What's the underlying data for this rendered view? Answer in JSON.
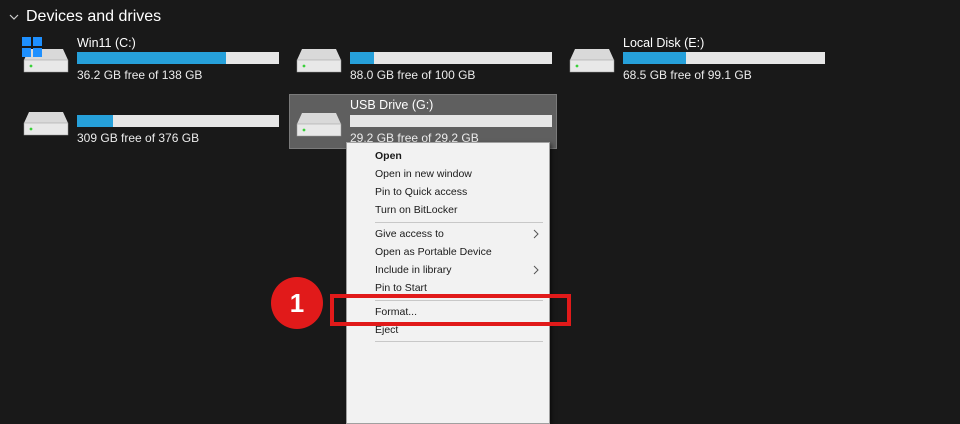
{
  "section": {
    "title": "Devices and drives"
  },
  "drives": [
    {
      "name": "Win11 (C:)",
      "free_text": "36.2 GB free of 138 GB",
      "used_fraction": 0.74,
      "icon": "windows-drive-icon"
    },
    {
      "name": "",
      "free_text": "88.0 GB free of 100 GB",
      "used_fraction": 0.12,
      "icon": "hard-drive-icon"
    },
    {
      "name": "Local Disk (E:)",
      "free_text": "68.5 GB free of 99.1 GB",
      "used_fraction": 0.31,
      "icon": "hard-drive-icon"
    },
    {
      "name": "",
      "free_text": "309 GB free of 376 GB",
      "used_fraction": 0.18,
      "icon": "hard-drive-icon"
    },
    {
      "name": "USB Drive (G:)",
      "free_text": "29.2 GB free of 29.2 GB",
      "used_fraction": 0.0,
      "icon": "usb-drive-icon"
    }
  ],
  "context_menu": {
    "items": [
      {
        "label": "Open",
        "bold": true
      },
      {
        "label": "Open in new window"
      },
      {
        "label": "Pin to Quick access"
      },
      {
        "label": "Turn on BitLocker"
      },
      {
        "label": "Give access to",
        "submenu": true
      },
      {
        "label": "Open as Portable Device"
      },
      {
        "label": "Include in library",
        "submenu": true
      },
      {
        "label": "Pin to Start"
      },
      {
        "label": "Format..."
      },
      {
        "label": "Eject"
      }
    ]
  },
  "annotation": {
    "step_number": "1"
  },
  "colors": {
    "background": "#191919",
    "accent_bar": "#26a0da",
    "highlight": "#e11a1a"
  }
}
